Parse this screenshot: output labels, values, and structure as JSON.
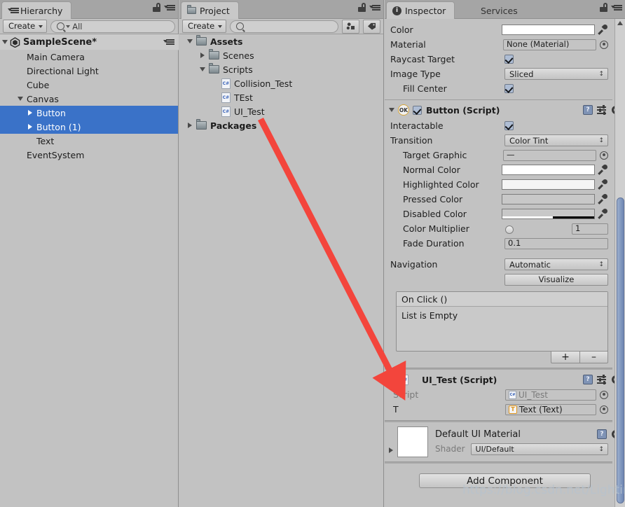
{
  "hierarchy": {
    "tab_label": "Hierarchy",
    "create_label": "Create",
    "search_value": "All",
    "scene_name": "SampleScene*",
    "items": [
      {
        "label": "Main Camera",
        "indent": 1,
        "arrow": "none",
        "selected": false
      },
      {
        "label": "Directional Light",
        "indent": 1,
        "arrow": "none",
        "selected": false
      },
      {
        "label": "Cube",
        "indent": 1,
        "arrow": "none",
        "selected": false
      },
      {
        "label": "Canvas",
        "indent": 1,
        "arrow": "open",
        "selected": false
      },
      {
        "label": "Button",
        "indent": 2,
        "arrow": "closed",
        "selected": true
      },
      {
        "label": "Button (1)",
        "indent": 2,
        "arrow": "closed",
        "selected": true
      },
      {
        "label": "Text",
        "indent": 2,
        "arrow": "none",
        "selected": false
      },
      {
        "label": "EventSystem",
        "indent": 1,
        "arrow": "none",
        "selected": false
      }
    ]
  },
  "project": {
    "tab_label": "Project",
    "create_label": "Create",
    "search_value": "",
    "items": [
      {
        "label": "Assets",
        "indent": 0,
        "arrow": "open",
        "icon": "folder",
        "bold": true
      },
      {
        "label": "Scenes",
        "indent": 1,
        "arrow": "closed",
        "icon": "folder",
        "bold": false
      },
      {
        "label": "Scripts",
        "indent": 1,
        "arrow": "open",
        "icon": "folder",
        "bold": false
      },
      {
        "label": "Collision_Test",
        "indent": 2,
        "arrow": "none",
        "icon": "cs",
        "bold": false
      },
      {
        "label": "TEst",
        "indent": 2,
        "arrow": "none",
        "icon": "cs",
        "bold": false
      },
      {
        "label": "UI_Test",
        "indent": 2,
        "arrow": "none",
        "icon": "cs",
        "bold": false
      },
      {
        "label": "Packages",
        "indent": 0,
        "arrow": "closed",
        "icon": "folder",
        "bold": true
      }
    ]
  },
  "inspector": {
    "tab_label": "Inspector",
    "services_tab_label": "Services",
    "image_props": [
      {
        "label": "Color",
        "type": "color",
        "value": "#ffffff",
        "indent": 0
      },
      {
        "label": "Material",
        "type": "object",
        "value": "None (Material)",
        "indent": 0
      },
      {
        "label": "Raycast Target",
        "type": "checkbox",
        "value": "checked",
        "indent": 0
      },
      {
        "label": "Image Type",
        "type": "dropdown",
        "value": "Sliced",
        "indent": 0
      },
      {
        "label": "Fill Center",
        "type": "checkbox",
        "value": "checked",
        "indent": 1
      }
    ],
    "button_script": {
      "title": "Button (Script)",
      "enabled": true,
      "icon_label": "OK",
      "props": [
        {
          "label": "Interactable",
          "type": "checkbox",
          "value": "checked",
          "indent": 0
        },
        {
          "label": "Transition",
          "type": "dropdown",
          "value": "Color Tint",
          "indent": 0
        },
        {
          "label": "Target Graphic",
          "type": "object",
          "value": "—",
          "indent": 1
        },
        {
          "label": "Normal Color",
          "type": "color",
          "value": "#ffffff",
          "indent": 1
        },
        {
          "label": "Highlighted Color",
          "type": "color",
          "value": "#f5f5f5",
          "indent": 1
        },
        {
          "label": "Pressed Color",
          "type": "color",
          "value": "#c8c8c8",
          "indent": 1
        },
        {
          "label": "Disabled Color",
          "type": "color-alpha",
          "value": "#c8c8c8",
          "indent": 1
        },
        {
          "label": "Color Multiplier",
          "type": "slider",
          "value": "1",
          "indent": 1
        },
        {
          "label": "Fade Duration",
          "type": "text",
          "value": "0.1",
          "indent": 1
        }
      ],
      "navigation_label": "Navigation",
      "navigation_value": "Automatic",
      "visualize_label": "Visualize",
      "onclick_title": "On Click ()",
      "onclick_empty": "List is Empty",
      "add_symbol": "+",
      "remove_symbol": "–"
    },
    "ui_test_script": {
      "title": "UI_Test (Script)",
      "script_label": "Script",
      "script_value": "UI_Test",
      "t_label": "T",
      "t_value": "Text (Text)"
    },
    "material": {
      "name": "Default UI Material",
      "shader_label": "Shader",
      "shader_value": "UI/Default"
    },
    "add_component_label": "Add Component"
  },
  "watermark": {
    "text": "https://blog.csdn.net/Lightinf"
  },
  "colors": {
    "panel_bg": "#c2c2c2",
    "selection_blue": "#3a72c8",
    "arrow_red": "#f3453c",
    "scroll_thumb_blue": "#7d93bb"
  }
}
